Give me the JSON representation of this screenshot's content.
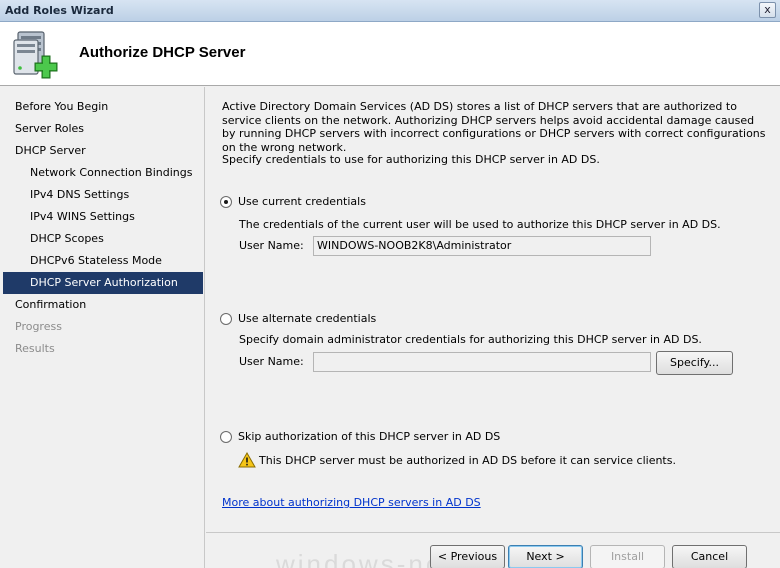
{
  "window": {
    "title": "Add Roles Wizard",
    "close_glyph": "x"
  },
  "header": {
    "page_title": "Authorize DHCP Server",
    "icon": "server-add-icon"
  },
  "sidebar": {
    "items": [
      {
        "label": "Before You Begin",
        "level": 0,
        "state": "normal"
      },
      {
        "label": "Server Roles",
        "level": 0,
        "state": "normal"
      },
      {
        "label": "DHCP Server",
        "level": 0,
        "state": "normal"
      },
      {
        "label": "Network Connection Bindings",
        "level": 1,
        "state": "normal"
      },
      {
        "label": "IPv4 DNS Settings",
        "level": 1,
        "state": "normal"
      },
      {
        "label": "IPv4 WINS Settings",
        "level": 1,
        "state": "normal"
      },
      {
        "label": "DHCP Scopes",
        "level": 1,
        "state": "normal"
      },
      {
        "label": "DHCPv6 Stateless Mode",
        "level": 1,
        "state": "normal"
      },
      {
        "label": "DHCP Server Authorization",
        "level": 1,
        "state": "active"
      },
      {
        "label": "Confirmation",
        "level": 0,
        "state": "normal"
      },
      {
        "label": "Progress",
        "level": 0,
        "state": "disabled"
      },
      {
        "label": "Results",
        "level": 0,
        "state": "disabled"
      }
    ]
  },
  "main": {
    "intro": "Active Directory Domain Services (AD DS) stores a list of DHCP servers that are authorized to service clients on the network. Authorizing DHCP servers helps avoid accidental damage caused by running DHCP servers with incorrect configurations or DHCP servers with correct configurations on the wrong network.",
    "specify_text": "Specify credentials to use for authorizing this DHCP server in AD DS.",
    "option_current": {
      "label": "Use current credentials",
      "checked": true,
      "description": "The credentials of the current user will be used to authorize this DHCP server in AD DS.",
      "username_label": "User Name:",
      "username_value": "WINDOWS-NOOB2K8\\Administrator"
    },
    "option_alternate": {
      "label": "Use alternate credentials",
      "checked": false,
      "description": "Specify domain administrator credentials for authorizing this DHCP server in AD DS.",
      "username_label": "User Name:",
      "username_value": "",
      "specify_button": "Specify..."
    },
    "option_skip": {
      "label": "Skip authorization of this DHCP server in AD DS",
      "checked": false,
      "warning": "This DHCP server must be authorized in AD DS before it can service clients."
    },
    "more_link": "More about authorizing DHCP servers in AD DS"
  },
  "footer": {
    "previous": "< Previous",
    "next": "Next >",
    "install": "Install",
    "cancel": "Cancel",
    "watermark": "windows-noob"
  }
}
